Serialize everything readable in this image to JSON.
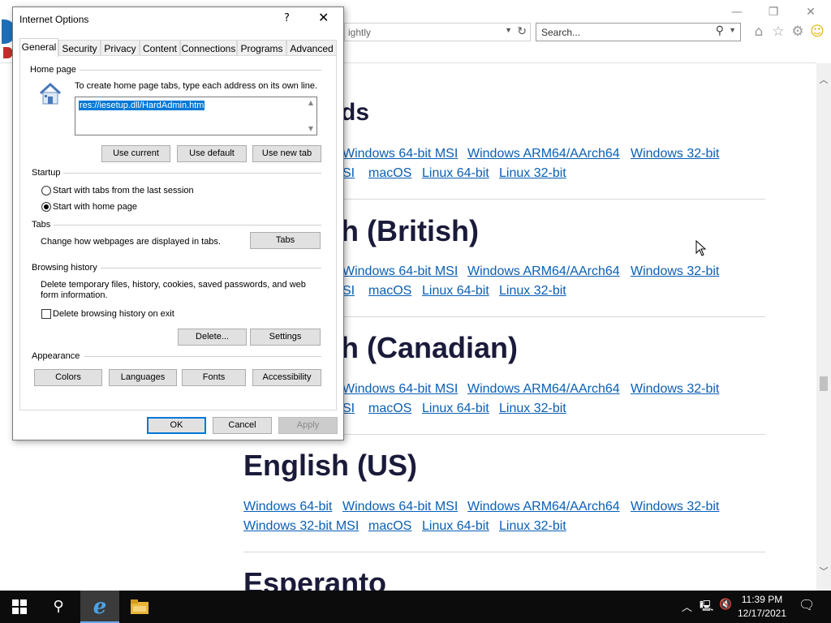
{
  "browser": {
    "address_fragment": "ightly",
    "search_placeholder": "Search...",
    "window_controls": {
      "minimize": "—",
      "restore": "❐",
      "close": "✕"
    },
    "toolbar_icons": [
      "home-icon",
      "favorites-star-icon",
      "settings-gear-icon",
      "feedback-smiley-icon"
    ]
  },
  "page": {
    "sections": [
      {
        "title": "ds",
        "links_row1": [
          "Windows 64-bit MSI",
          "Windows ARM64/AArch64",
          "Windows 32-bit"
        ],
        "links_row2": [
          "SI",
          "macOS",
          "Linux 64-bit",
          "Linux 32-bit"
        ]
      },
      {
        "title": "h (British)",
        "links_row1": [
          "Windows 64-bit MSI",
          "Windows ARM64/AArch64",
          "Windows 32-bit"
        ],
        "links_row2": [
          "SI",
          "macOS",
          "Linux 64-bit",
          "Linux 32-bit"
        ]
      },
      {
        "title": "h (Canadian)",
        "links_row1": [
          "Windows 64-bit MSI",
          "Windows ARM64/AArch64",
          "Windows 32-bit"
        ],
        "links_row2": [
          "SI",
          "macOS",
          "Linux 64-bit",
          "Linux 32-bit"
        ]
      },
      {
        "title": "English (US)",
        "links_row1": [
          "Windows 64-bit",
          "Windows 64-bit MSI",
          "Windows ARM64/AArch64",
          "Windows 32-bit"
        ],
        "links_row2": [
          "Windows 32-bit MSI",
          "macOS",
          "Linux 64-bit",
          "Linux 32-bit"
        ]
      },
      {
        "title": "Esperanto"
      }
    ]
  },
  "dialog": {
    "title": "Internet Options",
    "help": "?",
    "close": "✕",
    "tabs": [
      "General",
      "Security",
      "Privacy",
      "Content",
      "Connections",
      "Programs",
      "Advanced"
    ],
    "active_tab": "General",
    "home_page": {
      "label": "Home page",
      "instruction": "To create home page tabs, type each address on its own line.",
      "value": "res://iesetup.dll/HardAdmin.htm",
      "buttons": {
        "use_current": "Use current",
        "use_default": "Use default",
        "use_new_tab": "Use new tab"
      }
    },
    "startup": {
      "label": "Startup",
      "option_last_session": "Start with tabs from the last session",
      "option_home_page": "Start with home page",
      "selected": "option_home_page"
    },
    "tabs_group": {
      "label": "Tabs",
      "description": "Change how webpages are displayed in tabs.",
      "button": "Tabs"
    },
    "browsing_history": {
      "label": "Browsing history",
      "description_line1": "Delete temporary files, history, cookies, saved passwords, and web",
      "description_line2": "form information.",
      "checkbox_label": "Delete browsing history on exit",
      "checkbox_checked": false,
      "delete_button": "Delete...",
      "settings_button": "Settings"
    },
    "appearance": {
      "label": "Appearance",
      "colors": "Colors",
      "languages": "Languages",
      "fonts": "Fonts",
      "accessibility": "Accessibility"
    },
    "footer": {
      "ok": "OK",
      "cancel": "Cancel",
      "apply": "Apply"
    }
  },
  "taskbar": {
    "time": "11:39 PM",
    "date": "12/17/2021",
    "apps": [
      "start-icon",
      "search-icon",
      "internet-explorer-icon",
      "file-explorer-icon"
    ]
  }
}
